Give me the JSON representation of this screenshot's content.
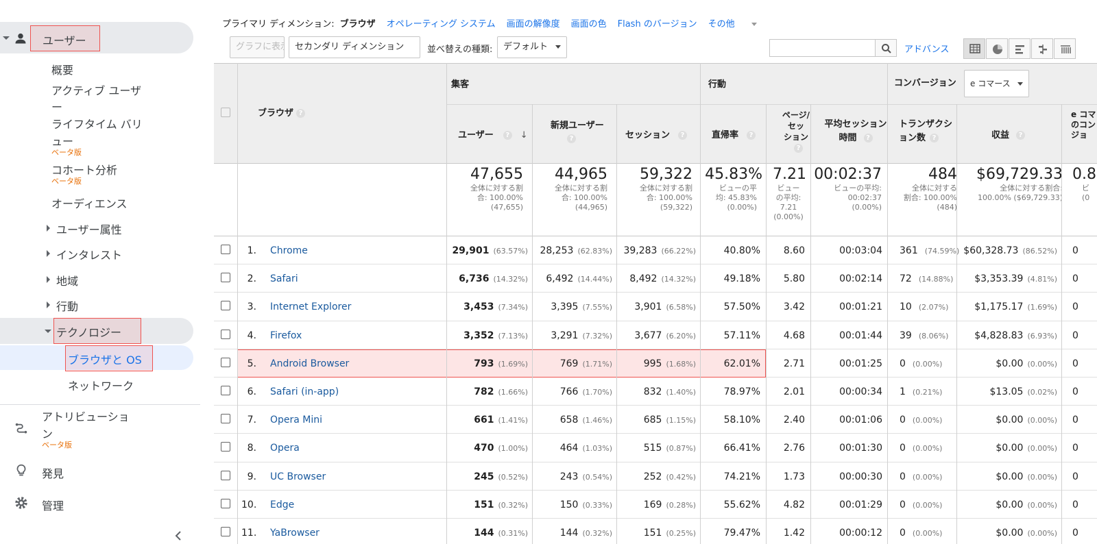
{
  "sidebar": {
    "users_label": "ユーザー",
    "items": {
      "overview": "概要",
      "active_users_1": "アクティブ ユーザ",
      "active_users_2": "ー",
      "lifetime_1": "ライフタイム バリ",
      "lifetime_2": "ュー",
      "lifetime_beta": "ベータ版",
      "cohort": "コホート分析",
      "cohort_beta": "ベータ版",
      "audience": "オーディエンス",
      "user_attributes": "ユーザー属性",
      "interests": "インタレスト",
      "geo": "地域",
      "behavior": "行動",
      "technology": "テクノロジー",
      "browser_os": "ブラウザと OS",
      "network": "ネットワーク"
    },
    "attribution_1": "アトリビューショ",
    "attribution_2": "ン",
    "attribution_beta": "ベータ版",
    "discover": "発見",
    "admin": "管理"
  },
  "dimension_bar": {
    "prefix": "プライマリ ディメンション:",
    "current": "ブラウザ",
    "os": "オペレーティング システム",
    "resolution": "画面の解像度",
    "color": "画面の色",
    "flash": "Flash のバージョン",
    "other": "その他"
  },
  "toolbar": {
    "graph_btn": "グラフに表示",
    "secondary_dim": "セカンダリ ディメンション",
    "sort_label": "並べ替えの種類:",
    "sort_value": "デフォルト",
    "search_placeholder": "",
    "advanced": "アドバンス"
  },
  "table": {
    "col_browser": "ブラウザ",
    "group_acq": "集客",
    "group_beh": "行動",
    "group_conv": "コンバージョン",
    "conv_select": "e コマース",
    "h_users": "ユーザー",
    "h_new_users": "新規ユーザー",
    "h_sessions": "セッション",
    "h_bounce": "直帰率",
    "h_pps_1": "ページ/",
    "h_pps_2": "セッ",
    "h_pps_3": "ション",
    "h_avg_1": "平均セッション",
    "h_avg_2": "時間",
    "h_trans_1": "トランザクシ",
    "h_trans_2": "ョン数",
    "h_revenue": "収益",
    "h_last_1": "e コマ",
    "h_last_2": "のコン",
    "h_last_3": "ジョ",
    "totals": {
      "users": "47,655",
      "users_sub": [
        "全体に対する割",
        "合: 100.00%",
        "(47,655)"
      ],
      "new_users": "44,965",
      "new_users_sub": [
        "全体に対する割",
        "合: 100.00%",
        "(44,965)"
      ],
      "sessions": "59,322",
      "sessions_sub": [
        "全体に対する割",
        "合: 100.00%",
        "(59,322)"
      ],
      "bounce": "45.83%",
      "bounce_sub": [
        "ビューの平",
        "均: 45.83%",
        "(0.00%)"
      ],
      "pps": "7.21",
      "pps_sub": [
        "ビュー",
        "の平均:",
        "7.21",
        "(0.00%)"
      ],
      "avg": "00:02:37",
      "avg_sub": [
        "ビューの平均:",
        "00:02:37",
        "(0.00%)"
      ],
      "trans": "484",
      "trans_sub": [
        "全体に対する",
        "割合: 100.00%",
        "(484)"
      ],
      "revenue": "$69,729.33",
      "revenue_sub": [
        "全体に対する割合:",
        "100.00% ($69,729.33)"
      ],
      "last": "0.8",
      "last_sub": [
        "ビ",
        "",
        "",
        "(0"
      ]
    },
    "rows": [
      {
        "n": "1.",
        "browser": "Chrome",
        "users": "29,901",
        "users_pct": "(63.57%)",
        "new": "28,253",
        "new_pct": "(62.83%)",
        "sess": "39,283",
        "sess_pct": "(66.22%)",
        "bounce": "40.80%",
        "pps": "8.60",
        "avg": "00:03:04",
        "trans": "361",
        "trans_pct": "(74.59%)",
        "rev": "$60,328.73",
        "rev_pct": "(86.52%)",
        "last": "0"
      },
      {
        "n": "2.",
        "browser": "Safari",
        "users": "6,736",
        "users_pct": "(14.32%)",
        "new": "6,492",
        "new_pct": "(14.44%)",
        "sess": "8,492",
        "sess_pct": "(14.32%)",
        "bounce": "49.18%",
        "pps": "5.80",
        "avg": "00:02:14",
        "trans": "72",
        "trans_pct": "(14.88%)",
        "rev": "$3,353.39",
        "rev_pct": "(4.81%)",
        "last": "0"
      },
      {
        "n": "3.",
        "browser": "Internet Explorer",
        "users": "3,453",
        "users_pct": "(7.34%)",
        "new": "3,395",
        "new_pct": "(7.55%)",
        "sess": "3,901",
        "sess_pct": "(6.58%)",
        "bounce": "57.50%",
        "pps": "3.42",
        "avg": "00:01:21",
        "trans": "10",
        "trans_pct": "(2.07%)",
        "rev": "$1,175.17",
        "rev_pct": "(1.69%)",
        "last": "0"
      },
      {
        "n": "4.",
        "browser": "Firefox",
        "users": "3,352",
        "users_pct": "(7.13%)",
        "new": "3,291",
        "new_pct": "(7.32%)",
        "sess": "3,677",
        "sess_pct": "(6.20%)",
        "bounce": "57.11%",
        "pps": "4.68",
        "avg": "00:01:44",
        "trans": "39",
        "trans_pct": "(8.06%)",
        "rev": "$4,828.83",
        "rev_pct": "(6.93%)",
        "last": "0"
      },
      {
        "n": "5.",
        "browser": "Android Browser",
        "users": "793",
        "users_pct": "(1.69%)",
        "new": "769",
        "new_pct": "(1.71%)",
        "sess": "995",
        "sess_pct": "(1.68%)",
        "bounce": "62.01%",
        "pps": "2.71",
        "avg": "00:01:25",
        "trans": "0",
        "trans_pct": "(0.00%)",
        "rev": "$0.00",
        "rev_pct": "(0.00%)",
        "last": "0"
      },
      {
        "n": "6.",
        "browser": "Safari (in-app)",
        "users": "782",
        "users_pct": "(1.66%)",
        "new": "766",
        "new_pct": "(1.70%)",
        "sess": "832",
        "sess_pct": "(1.40%)",
        "bounce": "78.97%",
        "pps": "2.01",
        "avg": "00:00:34",
        "trans": "1",
        "trans_pct": "(0.21%)",
        "rev": "$13.05",
        "rev_pct": "(0.02%)",
        "last": "0"
      },
      {
        "n": "7.",
        "browser": "Opera Mini",
        "users": "661",
        "users_pct": "(1.41%)",
        "new": "658",
        "new_pct": "(1.46%)",
        "sess": "685",
        "sess_pct": "(1.15%)",
        "bounce": "58.10%",
        "pps": "2.40",
        "avg": "00:01:06",
        "trans": "0",
        "trans_pct": "(0.00%)",
        "rev": "$0.00",
        "rev_pct": "(0.00%)",
        "last": "0"
      },
      {
        "n": "8.",
        "browser": "Opera",
        "users": "470",
        "users_pct": "(1.00%)",
        "new": "464",
        "new_pct": "(1.03%)",
        "sess": "515",
        "sess_pct": "(0.87%)",
        "bounce": "66.41%",
        "pps": "2.76",
        "avg": "00:01:30",
        "trans": "0",
        "trans_pct": "(0.00%)",
        "rev": "$0.00",
        "rev_pct": "(0.00%)",
        "last": "0"
      },
      {
        "n": "9.",
        "browser": "UC Browser",
        "users": "245",
        "users_pct": "(0.52%)",
        "new": "243",
        "new_pct": "(0.54%)",
        "sess": "252",
        "sess_pct": "(0.42%)",
        "bounce": "74.21%",
        "pps": "1.73",
        "avg": "00:00:30",
        "trans": "0",
        "trans_pct": "(0.00%)",
        "rev": "$0.00",
        "rev_pct": "(0.00%)",
        "last": "0"
      },
      {
        "n": "10.",
        "browser": "Edge",
        "users": "151",
        "users_pct": "(0.32%)",
        "new": "150",
        "new_pct": "(0.33%)",
        "sess": "169",
        "sess_pct": "(0.28%)",
        "bounce": "55.62%",
        "pps": "4.82",
        "avg": "00:01:29",
        "trans": "0",
        "trans_pct": "(0.00%)",
        "rev": "$0.00",
        "rev_pct": "(0.00%)",
        "last": "0"
      },
      {
        "n": "11.",
        "browser": "YaBrowser",
        "users": "144",
        "users_pct": "(0.31%)",
        "new": "144",
        "new_pct": "(0.32%)",
        "sess": "151",
        "sess_pct": "(0.25%)",
        "bounce": "79.47%",
        "pps": "1.42",
        "avg": "00:00:12",
        "trans": "0",
        "trans_pct": "(0.00%)",
        "rev": "$0.00",
        "rev_pct": "(0.00%)",
        "last": "0"
      }
    ]
  },
  "colors": {
    "highlight": "#ef5350",
    "link": "#1a5a9e",
    "accent": "#1a73e8",
    "beta": "#e8710a"
  }
}
